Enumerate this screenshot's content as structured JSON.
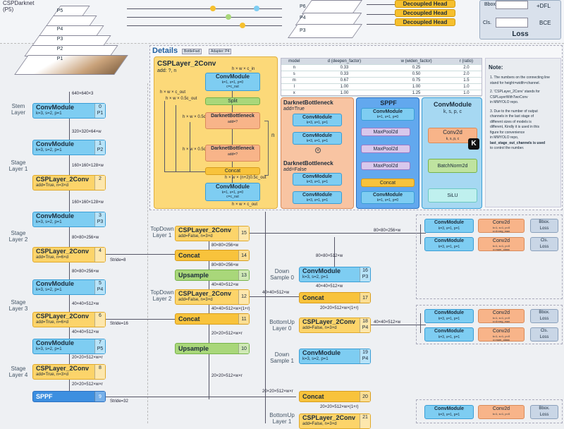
{
  "backbone_title": "CSPDarknet\n(P5)",
  "pyramid_left": [
    "P5",
    "P4",
    "P3",
    "P2",
    "P1"
  ],
  "pyramid_right": [
    "P6",
    "P4",
    "P3"
  ],
  "top_heads": [
    "Decoupled Head",
    "Decoupled Head",
    "Decoupled Head"
  ],
  "loss": {
    "title": "Loss",
    "dfl": "+DFL",
    "bce": "BCE",
    "cls": "Cls.",
    "bbox_lbl": "Bbox."
  },
  "details": {
    "title": "Details",
    "tag1": "BottleFwd",
    "tag2": "Adapter: P4"
  },
  "csp_detail": {
    "title": "CSPLayer_2Conv",
    "sub": "add: ?, n",
    "conv1": "ConvModule",
    "conv1_sub": "k=1, s=1, p=0\nc=c_out",
    "split": "Split",
    "db1": "DarknetBottleneck",
    "db1_sub": "add=?",
    "db2": "DarknetBottleneck",
    "db2_sub": "add=?",
    "concat": "Concat",
    "conv2": "ConvModule",
    "conv2_sub": "k=1, s=1, p=0\nc=c_out",
    "n": "n",
    "d1": "h × w × c_in",
    "d2": "h × w × c_out",
    "d3": "h × w × 0.5c_out",
    "d4": "h × w × 0.5c_out",
    "d5": "h × w × 0.5c_out",
    "d6": "h × w × (n+2)0.5c_out",
    "d7": "h × w × c_out"
  },
  "model_table": {
    "headers": [
      "model",
      "d (deepen_factor)",
      "w (widen_factor)",
      "r (ratio)"
    ],
    "rows": [
      [
        "n",
        "0.33",
        "0.25",
        "2.0"
      ],
      [
        "s",
        "0.33",
        "0.50",
        "2.0"
      ],
      [
        "m",
        "0.67",
        "0.75",
        "1.5"
      ],
      [
        "l",
        "1.00",
        "1.00",
        "1.0"
      ],
      [
        "x",
        "1.00",
        "1.25",
        "1.0"
      ]
    ]
  },
  "db_true": {
    "title": "DarknetBottleneck",
    "sub": "add=True",
    "c1": "ConvModule",
    "c1s": "k=3, s=1, p=1",
    "c2": "ConvModule",
    "c2s": "k=3, s=1, p=1"
  },
  "db_false": {
    "title": "DarknetBottleneck",
    "sub": "add=False",
    "c1": "ConvModule",
    "c1s": "k=3, s=1, p=1",
    "c2": "ConvModule",
    "c2s": "k=3, s=1, p=1"
  },
  "sppf_detail": {
    "title": "SPPF",
    "c1": "ConvModule",
    "c1s": "k=1, s=1, p=0",
    "m1": "MaxPool2d",
    "m2": "MaxPool2d",
    "m3": "MaxPool2d",
    "concat": "Concat",
    "c2": "ConvModule",
    "c2s": "k=1, s=1, p=0"
  },
  "conv_detail": {
    "title": "ConvModule",
    "sub": "k, s, p, c",
    "a": "Conv2d",
    "as": "k, s, p, c",
    "b": "BatchNorm2d",
    "c": "SiLU"
  },
  "note": {
    "title": "Note:",
    "lines": [
      "1.  The numbers on the connecting line",
      "stand for height×width×channel.",
      "2. 'CSPLayer_2Conv' stands for",
      "CSPLayerWithTwoConv",
      "in MMYOLO repo.",
      "3. Due to the number of output",
      "channels in the last stage of",
      "different sizes of models is",
      "different, Kindly it is used in this",
      "figure for convenience",
      "in MMYOLO repo,",
      "last_stage_out_channels is used",
      "to control the number."
    ]
  },
  "backbone": [
    {
      "name": "ConvModule",
      "sub": "k=3, s=2, p=1",
      "idx": "0",
      "p": "P1",
      "dim": "640×640×3"
    },
    {
      "name": "ConvModule",
      "sub": "k=3, s=2, p=1",
      "idx": "1",
      "p": "P2",
      "dim": "320×320×64×w"
    },
    {
      "name": "CSPLayer_2Conv",
      "sub": "add=True, n=3×d",
      "idx": "2",
      "p": "",
      "dim": "160×160×128×w"
    },
    {
      "name": "ConvModule",
      "sub": "k=3, s=2, p=1",
      "idx": "3",
      "p": "P3",
      "dim": "160×160×128×w"
    },
    {
      "name": "CSPLayer_2Conv",
      "sub": "add=True, n=6×d",
      "idx": "4",
      "p": "",
      "dim": "80×80×256×w"
    },
    {
      "name": "ConvModule",
      "sub": "k=3, s=2, p=1",
      "idx": "5",
      "p": "P4",
      "dim": "80×80×256×w"
    },
    {
      "name": "CSPLayer_2Conv",
      "sub": "add=True, n=6×d",
      "idx": "6",
      "p": "",
      "dim": "40×40×512×w"
    },
    {
      "name": "ConvModule",
      "sub": "k=3, s=2, p=1",
      "idx": "7",
      "p": "P5",
      "dim": "40×40×512×w"
    },
    {
      "name": "CSPLayer_2Conv",
      "sub": "add=True, n=3×d",
      "idx": "8",
      "p": "",
      "dim": "20×20×512×w×r"
    },
    {
      "name": "SPPF",
      "sub": "",
      "idx": "9",
      "p": "",
      "dim": "20×20×512×w×r"
    }
  ],
  "stages": [
    "Stem\nLayer",
    "Stage\nLayer 1",
    "Stage\nLayer 2",
    "Stage\nLayer 3",
    "Stage\nLayer 4"
  ],
  "strides": [
    "Stride=8",
    "Stride=16",
    "Stride=32"
  ],
  "neck_mid": [
    {
      "name": "CSPLayer_2Conv",
      "sub": "add=False, n=3×d",
      "idx": "15"
    },
    {
      "name": "Concat",
      "sub": "",
      "idx": "14"
    },
    {
      "name": "Upsample",
      "sub": "",
      "idx": "13"
    },
    {
      "name": "CSPLayer_2Conv",
      "sub": "add=False, n=3×d",
      "idx": "12"
    },
    {
      "name": "Concat",
      "sub": "",
      "idx": "11"
    },
    {
      "name": "Upsample",
      "sub": "",
      "idx": "10"
    }
  ],
  "neck_mid_labels": [
    "TopDown\nLayer 1",
    "TopDown\nLayer 2"
  ],
  "neck_right": [
    {
      "name": "ConvModule",
      "sub": "k=3, s=2, p=1",
      "idx": "16",
      "p": "P3"
    },
    {
      "name": "Concat",
      "sub": "",
      "idx": "17"
    },
    {
      "name": "CSPLayer_2Conv",
      "sub": "add=False, n=3×d",
      "idx": "18",
      "p": "P4"
    },
    {
      "name": "ConvModule",
      "sub": "k=3, s=2, p=1",
      "idx": "19",
      "p": "P4"
    },
    {
      "name": "Concat",
      "sub": "",
      "idx": "20"
    },
    {
      "name": "CSPLayer_2Conv",
      "sub": "add=False, n=3×d",
      "idx": "21"
    }
  ],
  "neck_right_labels": [
    "Down\nSample 0",
    "BottomUp\nLayer 0",
    "Down\nSample 1",
    "BottomUp\nLayer 1"
  ],
  "neck_dims": [
    "80×80×256×w",
    "80×80×512×w",
    "40×40×512×w",
    "40×40×512×w",
    "20×20×512×w×r",
    "40×40×512×w",
    "20×20×512×w×(1+r)",
    "80×80×256×w",
    "40×40×512×w",
    "20×20×512×w×r",
    "40×40×512×w×(1+r)",
    "80×80×512×w",
    "40×40×512×w"
  ],
  "heads": [
    {
      "conv": "ConvModule",
      "cs": "k=3, s=1, p=1",
      "conv2": "Conv2d",
      "c2s": "k=1, s=1, p=0\nc=4×reg_max",
      "loss": "Bbox.\nLoss"
    },
    {
      "conv": "ConvModule",
      "cs": "k=3, s=1, p=1",
      "conv2": "Conv2d",
      "c2s": "k=1, s=1, p=0\nc=num_class",
      "loss": "Cls.\nLoss"
    },
    {
      "conv": "ConvModule",
      "cs": "k=3, s=1, p=1",
      "conv2": "Conv2d",
      "c2s": "k=1, s=1, p=0\nc=4×reg_max",
      "loss": "Bbox.\nLoss"
    },
    {
      "conv": "ConvModule",
      "cs": "k=3, s=1, p=1",
      "conv2": "Conv2d",
      "c2s": "k=1, s=1, p=0\nc=num_class",
      "loss": "Cls.\nLoss"
    },
    {
      "conv": "ConvModule",
      "cs": "k=3, s=1, p=1",
      "conv2": "Conv2d",
      "c2s": "k=1, s=1, p=0",
      "loss": "Bbox.\nLoss"
    }
  ],
  "k_badge": "K",
  "colors": {
    "conv": "#7ecdf2",
    "csp": "#fcd46a",
    "concat": "#f8c33c",
    "upsample": "#a9d77a",
    "sppf": "#3d8fe0",
    "conv2d": "#f8b489"
  }
}
